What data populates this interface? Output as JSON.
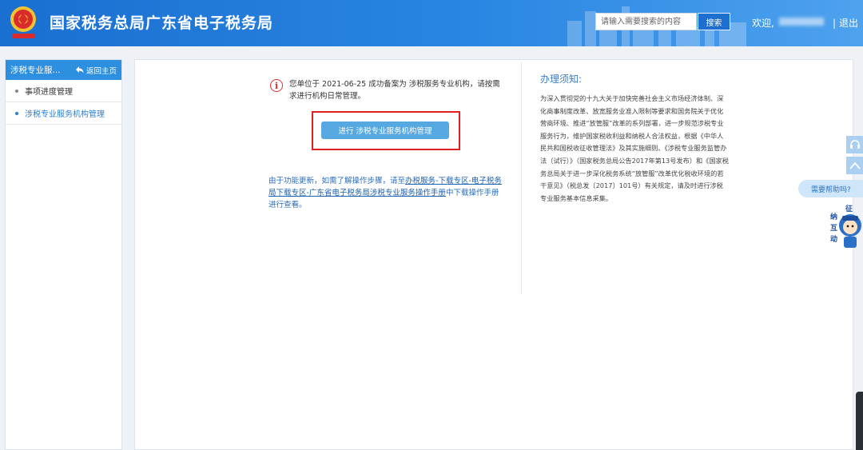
{
  "header": {
    "title": "国家税务总局广东省电子税务局",
    "search_placeholder": "请输入需要搜索的内容",
    "search_button": "搜索",
    "welcome": "欢迎,",
    "separator": "|",
    "logout": "退出",
    "brand_color": "#1a6fd0"
  },
  "sidebar": {
    "title": "涉税专业服...",
    "back_label": "返回主页",
    "items": [
      {
        "label": "事项进度管理",
        "active": false
      },
      {
        "label": "涉税专业服务机构管理",
        "active": true
      }
    ]
  },
  "main": {
    "notice": "您单位于 2021-06-25 成功备案为 涉税服务专业机构，请按需求进行机构日常管理。",
    "manage_button": "进行 涉税专业服务机构管理",
    "help_prefix": "由于功能更新，如需了解操作步骤，请至",
    "help_link": "办税服务-下载专区-电子税务局下载专区-广东省电子税务局涉税专业服务操作手册",
    "help_suffix": "中下载操作手册进行查看。"
  },
  "notes": {
    "title": "办理须知:",
    "body": "为深入贯彻党的十九大关于加快完善社会主义市场经济体制、深化商事制度改革、放宽服务业准入限制等要求和国务院关于优化营商环境、推进“放管服”改革的系列部署，进一步规范涉税专业服务行为，维护国家税收利益和纳税人合法权益，根据《中华人民共和国税收征收管理法》及其实施细则、《涉税专业服务监管办法（试行）》（国家税务总局公告2017年第13号发布）和《国家税务总局关于进一步深化税务系统“放管服”改革优化税收环境的若干意见》（税总发〔2017〕101号）有关规定，请及时进行涉税专业服务基本信息采集。"
  },
  "widgets": {
    "help_label": "需要帮助吗?",
    "mascot_text": [
      "征",
      "纳",
      "互",
      "动"
    ]
  }
}
